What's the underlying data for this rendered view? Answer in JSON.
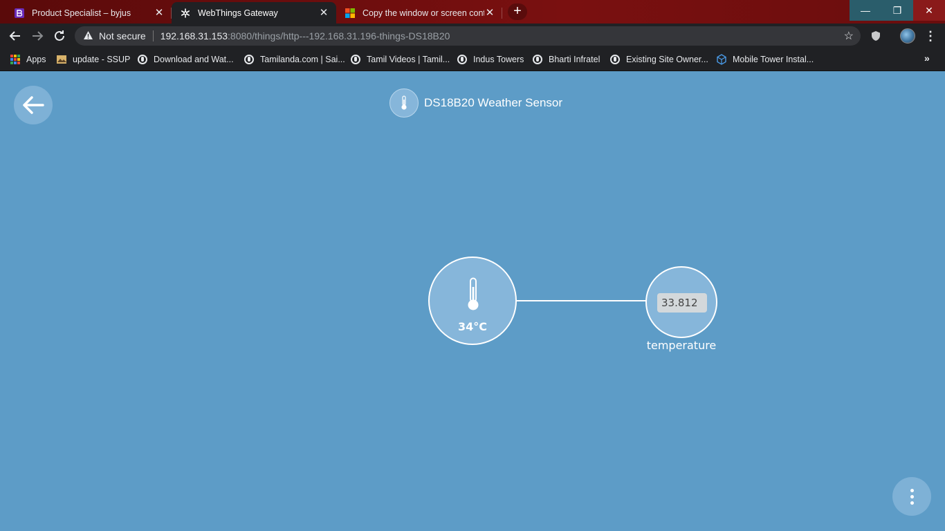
{
  "browser": {
    "tabs": [
      {
        "title": "Product Specialist – byjus",
        "active": false,
        "favicon": "byjus-icon"
      },
      {
        "title": "WebThings Gateway",
        "active": true,
        "favicon": "webthings-icon"
      },
      {
        "title": "Copy the window or screen conte",
        "active": false,
        "favicon": "microsoft-icon"
      }
    ],
    "new_tab_label": "+",
    "window_controls": {
      "minimize": "—",
      "maximize": "❐",
      "close": "✕"
    }
  },
  "toolbar": {
    "security_label": "Not secure",
    "url_host": "192.168.31.153",
    "url_path": ":8080/things/http---192.168.31.196-things-DS18B20"
  },
  "bookmarks": [
    {
      "label": "Apps",
      "icon": "apps-grid-icon"
    },
    {
      "label": "update - SSUP",
      "icon": "bookmark-favicon"
    },
    {
      "label": "Download and Wat...",
      "icon": "globe-icon"
    },
    {
      "label": "Tamilanda.com | Sai...",
      "icon": "globe-icon"
    },
    {
      "label": "Tamil Videos | Tamil...",
      "icon": "globe-icon"
    },
    {
      "label": "Indus Towers",
      "icon": "globe-icon"
    },
    {
      "label": "Bharti Infratel",
      "icon": "globe-icon"
    },
    {
      "label": "Existing Site Owner...",
      "icon": "globe-icon"
    },
    {
      "label": "Mobile Tower Instal...",
      "icon": "cube-icon"
    }
  ],
  "page": {
    "thing_title": "DS18B20 Weather Sensor",
    "main_reading": "34°C",
    "property": {
      "value": "33.812",
      "label": "temperature"
    },
    "colors": {
      "background": "#5d9cc7",
      "circle": "#86b6da",
      "button": "#7eb1d6"
    }
  }
}
